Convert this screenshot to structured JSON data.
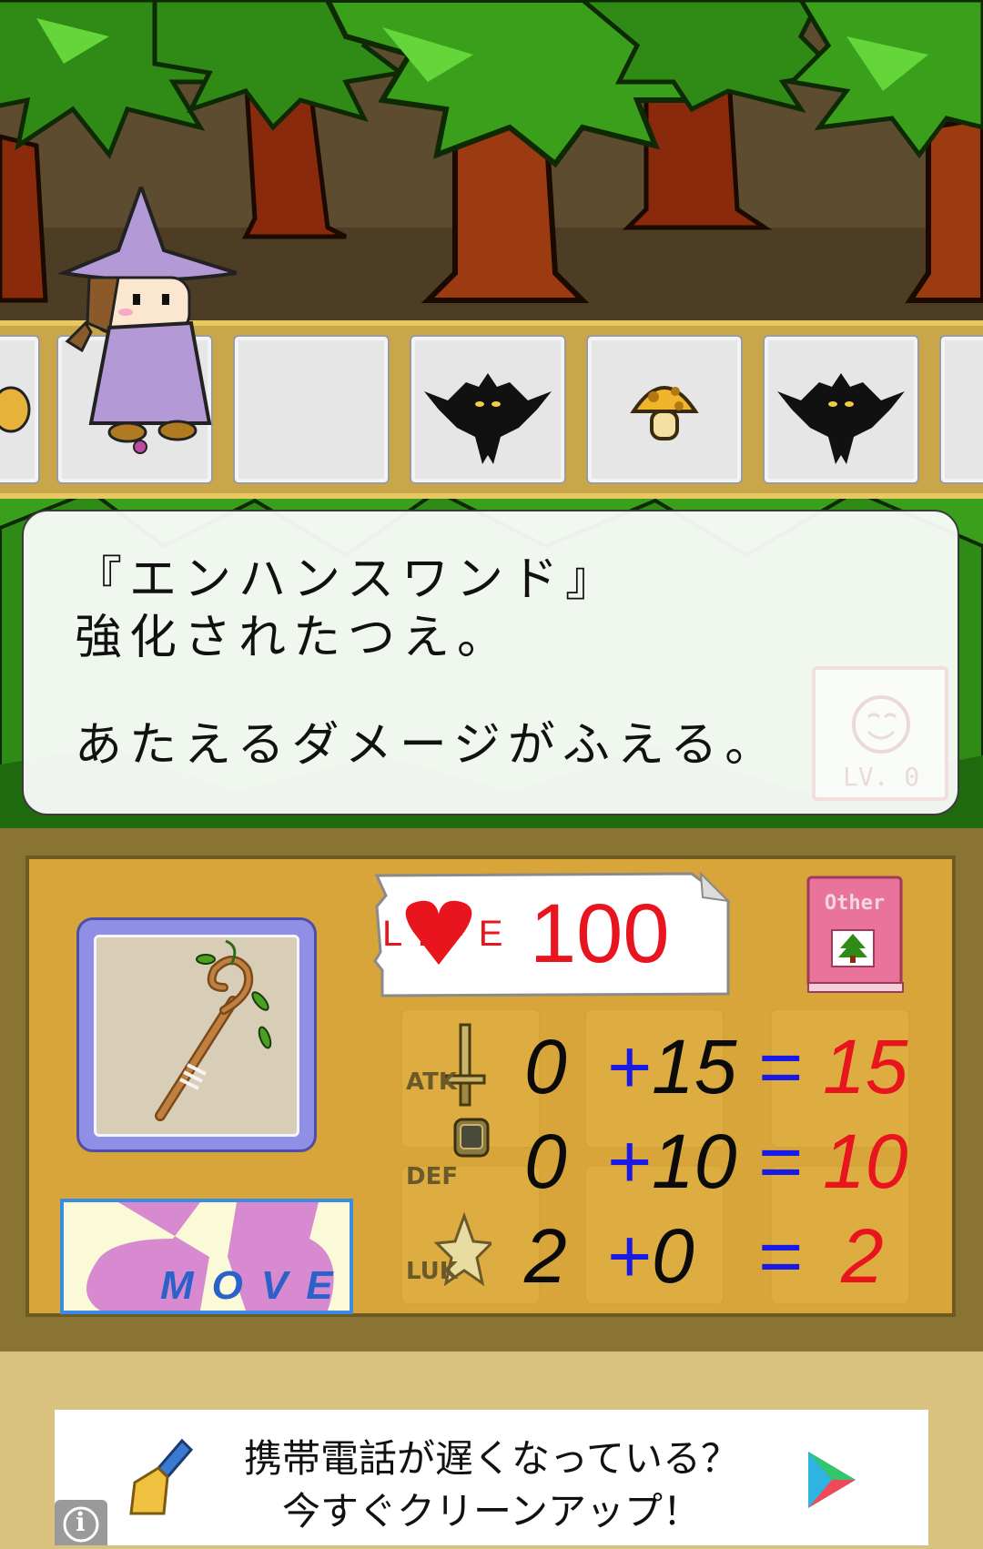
{
  "dialog": {
    "line1": "『エンハンスワンド』",
    "line2": "強化されたつえ。",
    "line3": "あたえるダメージがふえる。",
    "mood_level": "LV. 0"
  },
  "status": {
    "life_label": "LIFE",
    "life_value": "100",
    "other_label": "Other"
  },
  "stats": [
    {
      "name": "ATK",
      "base": "0",
      "plus": "+",
      "bonus": "15",
      "equals": "=",
      "total": "15"
    },
    {
      "name": "DEF",
      "base": "0",
      "plus": "+",
      "bonus": "10",
      "equals": "=",
      "total": "10"
    },
    {
      "name": "LUK",
      "base": "2",
      "plus": "+",
      "bonus": "0",
      "equals": "=",
      "total": "2"
    }
  ],
  "move_button": {
    "label": "MOVE"
  },
  "track": {
    "tiles": [
      "partial-item",
      "player-witch",
      "empty",
      "bat-enemy",
      "mushroom-item",
      "bat-enemy",
      "partial-empty"
    ]
  },
  "ad": {
    "line1": "携帯電話が遅くなっている？",
    "line2": "今すぐクリーンアップ！",
    "info": "i"
  },
  "colors": {
    "life": "#e8141e",
    "stat_base": "#0b0b0b",
    "stat_operator": "#1a1ae6",
    "stat_total": "#e8141e",
    "panel": "#d7a53a",
    "move_border": "#3b8be0"
  }
}
